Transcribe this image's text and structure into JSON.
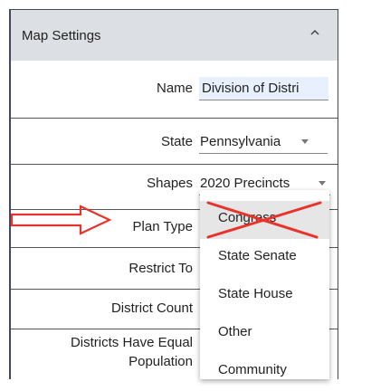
{
  "panel": {
    "title": "Map Settings",
    "collapse_icon": "chevron-up-icon"
  },
  "fields": {
    "name": {
      "label": "Name",
      "value": "Division of Distri"
    },
    "state": {
      "label": "State",
      "value": "Pennsylvania"
    },
    "shapes": {
      "label": "Shapes",
      "value": "2020 Precincts"
    },
    "plan_type": {
      "label": "Plan Type"
    },
    "restrict_to": {
      "label": "Restrict To"
    },
    "district_count": {
      "label": "District Count"
    },
    "equal_population": {
      "label_line1": "Districts Have Equal",
      "label_line2": "Population"
    }
  },
  "dropdown": {
    "options": [
      "Congress",
      "State Senate",
      "State House",
      "Other",
      "Community"
    ],
    "highlighted": "Congress"
  },
  "annotations": {
    "arrow_color": "#e8332a",
    "x_color": "#e8332a"
  },
  "colors": {
    "header_bg": "#dcdfe3",
    "input_bg": "#e8f0fe"
  }
}
